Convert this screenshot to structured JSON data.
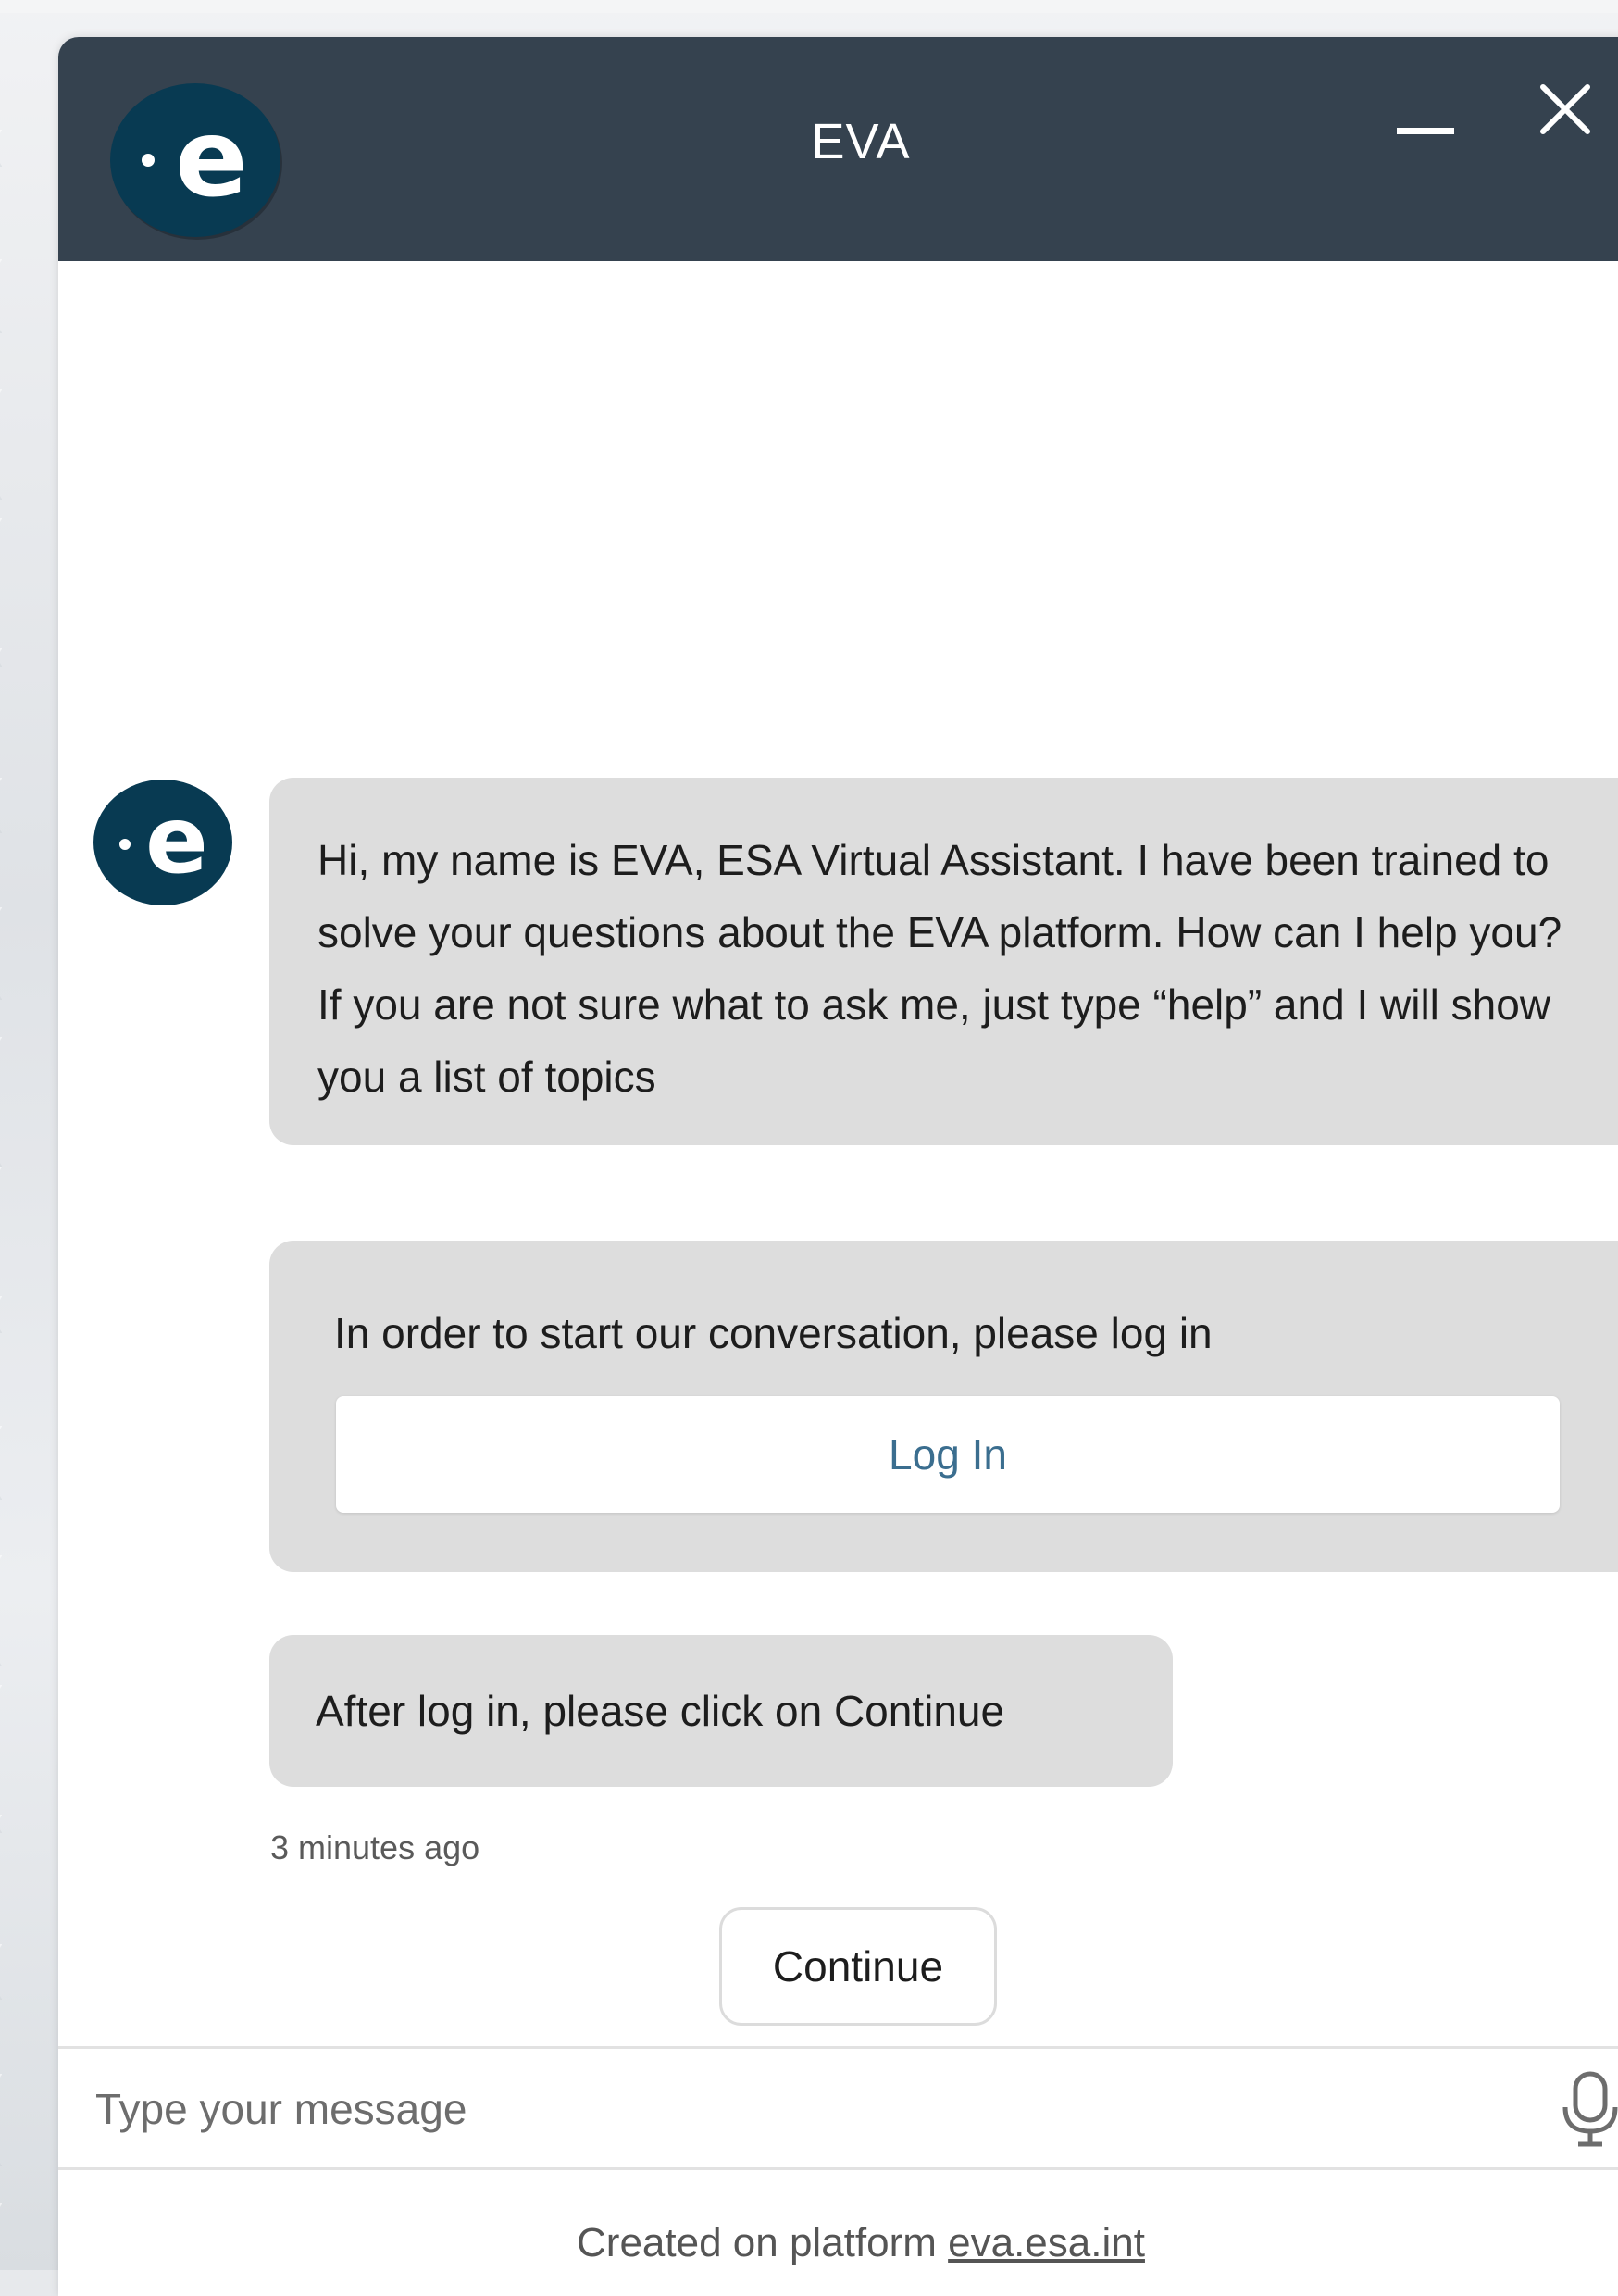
{
  "header": {
    "title": "EVA",
    "logo_icon": "eva-logo-icon",
    "minimize_icon": "minimize-icon",
    "close_icon": "close-icon",
    "background_color": "#35424f"
  },
  "messages": [
    {
      "id": "greeting",
      "text": "Hi, my name is EVA, ESA Virtual Assistant. I have been trained to solve your questions about the EVA platform. How can I help you? If you are not sure what to ask me, just type “help” and I will show you a list of topics"
    },
    {
      "id": "login-prompt",
      "text": "In order to start our conversation, please log in",
      "button_label": "Log In"
    },
    {
      "id": "continue-instruction",
      "text": "After log in, please click on Continue"
    }
  ],
  "timestamp": "3 minutes ago",
  "quick_reply": {
    "label": "Continue"
  },
  "composer": {
    "placeholder": "Type your message",
    "mic_icon": "microphone-icon"
  },
  "footer": {
    "prefix": "Created on platform",
    "link_text": "eva.esa.int"
  },
  "colors": {
    "bubble": "#dddddd",
    "link_button_text": "#3b6e8f",
    "logo_circle": "#083a52"
  }
}
